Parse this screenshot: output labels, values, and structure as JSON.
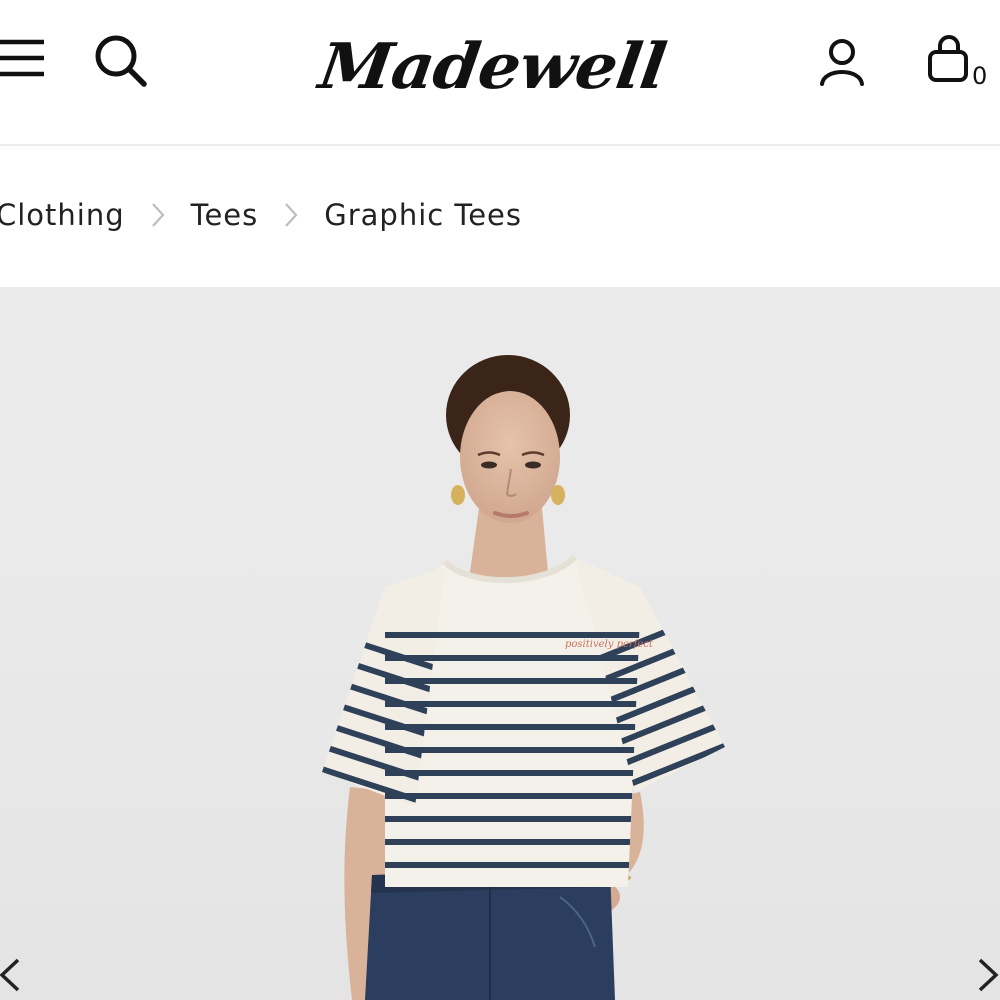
{
  "header": {
    "logo_text": "Madewell",
    "bag_count": "0",
    "icons": {
      "menu": "hamburger-menu-icon",
      "search": "search-icon",
      "account": "user-icon",
      "bag": "shopping-bag-icon"
    }
  },
  "breadcrumb": {
    "items": [
      "Clothing",
      "Tees",
      "Graphic Tees"
    ],
    "separator_icon": "chevron-right-icon"
  },
  "product_image": {
    "shirt_embroidery": "positively perfect",
    "colors": {
      "background": "#e9e9e9",
      "stripe": "#2f4159",
      "shirt": "#f4f1ea",
      "denim": "#2b3e60"
    }
  },
  "carousel": {
    "prev_icon": "chevron-left-icon",
    "next_icon": "chevron-right-icon"
  }
}
